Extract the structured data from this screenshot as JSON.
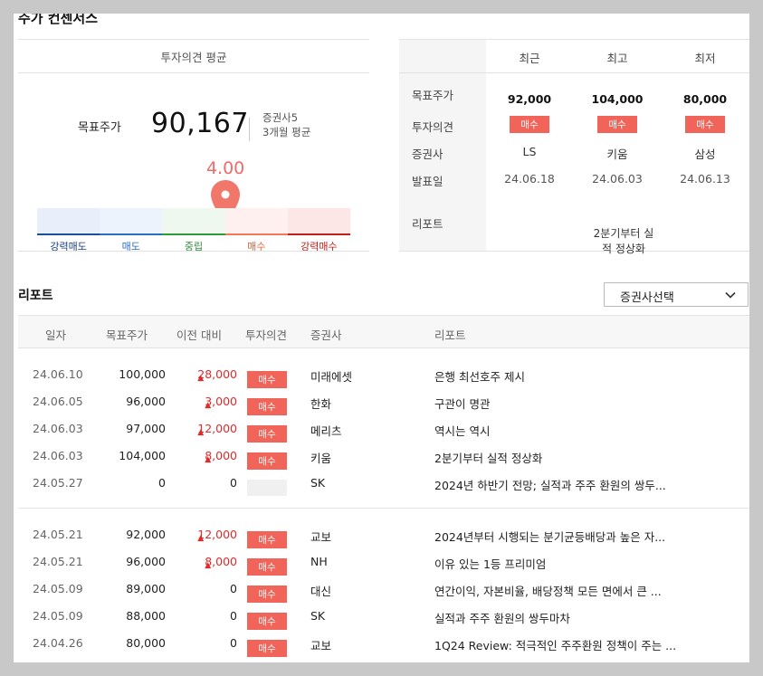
{
  "section_title": "주가 컨센서스",
  "consensus": {
    "header": "투자의견 평균",
    "target_label": "목표주가",
    "target_value": "90,167",
    "brokers_count": "증권사5",
    "period": "3개월 평균",
    "gauge_value": "4.00",
    "gauge_position_fraction": 0.6,
    "gauge_labels": [
      "강력매도",
      "매도",
      "중립",
      "매수",
      "강력매수"
    ],
    "gauge_colors": {
      "seg_fills": [
        "#e8eefa",
        "#edf3fc",
        "#eef8ee",
        "#fdf0ef",
        "#fde6e6"
      ],
      "bar_colors": [
        "#1a4fa0",
        "#2b6cc4",
        "#2e9a3a",
        "#f07a5a",
        "#c0201a"
      ],
      "label_colors": [
        "#1a3f80",
        "#2b6cc4",
        "#2e8a3a",
        "#e8603a",
        "#c0201a"
      ],
      "pin": "#f0776a"
    }
  },
  "summary": {
    "columns": [
      "최근",
      "최고",
      "최저"
    ],
    "row_labels": [
      "목표주가",
      "투자의견",
      "증권사",
      "발표일",
      "리포트"
    ],
    "target_prices": [
      "92,000",
      "104,000",
      "80,000"
    ],
    "opinions": [
      "매수",
      "매수",
      "매수"
    ],
    "brokers": [
      "LS",
      "키움",
      "삼성"
    ],
    "dates": [
      "24.06.18",
      "24.06.03",
      "24.06.13"
    ],
    "report_line1": "2분기부터 실",
    "report_line2": "적 정상화"
  },
  "reports": {
    "title": "리포트",
    "select_label": "증권사선택",
    "headers": [
      "일자",
      "목표주가",
      "이전 대비",
      "투자의견",
      "증권사",
      "리포트"
    ],
    "rows": [
      {
        "date": "24.06.10",
        "target": "100,000",
        "diff": "28,000",
        "up": true,
        "opinion": "매수",
        "broker": "미래에셋",
        "report": "은행 최선호주 제시"
      },
      {
        "date": "24.06.05",
        "target": "96,000",
        "diff": "3,000",
        "up": true,
        "opinion": "매수",
        "broker": "한화",
        "report": "구관이 명관"
      },
      {
        "date": "24.06.03",
        "target": "97,000",
        "diff": "12,000",
        "up": true,
        "opinion": "매수",
        "broker": "메리츠",
        "report": "역시는 역시"
      },
      {
        "date": "24.06.03",
        "target": "104,000",
        "diff": "8,000",
        "up": true,
        "opinion": "매수",
        "broker": "키움",
        "report": "2분기부터 실적 정상화"
      },
      {
        "date": "24.05.27",
        "target": "0",
        "diff": "0",
        "up": false,
        "opinion": "",
        "broker": "SK",
        "report": "2024년 하반기 전망; 실적과 주주 환원의 쌍두..."
      },
      {
        "date": "24.05.21",
        "target": "92,000",
        "diff": "12,000",
        "up": true,
        "opinion": "매수",
        "broker": "교보",
        "report": "2024년부터 시행되는 분기균등배당과 높은 자..."
      },
      {
        "date": "24.05.21",
        "target": "96,000",
        "diff": "8,000",
        "up": true,
        "opinion": "매수",
        "broker": "NH",
        "report": "이유 있는 1등 프리미엄"
      },
      {
        "date": "24.05.09",
        "target": "89,000",
        "diff": "0",
        "up": false,
        "opinion": "매수",
        "broker": "대신",
        "report": "연간이익, 자본비율, 배당정책 모든 면에서 큰 ..."
      },
      {
        "date": "24.05.09",
        "target": "88,000",
        "diff": "0",
        "up": false,
        "opinion": "매수",
        "broker": "SK",
        "report": "실적과 주주 환원의 쌍두마차"
      },
      {
        "date": "24.04.26",
        "target": "80,000",
        "diff": "0",
        "up": false,
        "opinion": "매수",
        "broker": "교보",
        "report": "1Q24 Review: 적극적인 주주환원 정책이 주는 ..."
      }
    ]
  }
}
